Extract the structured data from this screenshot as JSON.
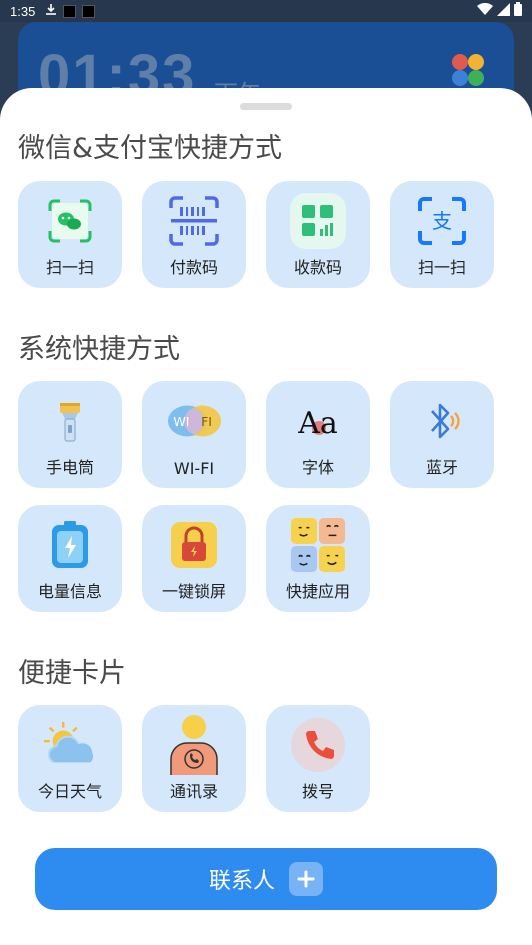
{
  "status_bar": {
    "time": "1:35"
  },
  "background": {
    "clock": "01:33",
    "ampm": "下午"
  },
  "sections": {
    "pay": {
      "title": "微信&支付宝快捷方式",
      "items": [
        {
          "label": "扫一扫",
          "icon": "wechat-scan-icon"
        },
        {
          "label": "付款码",
          "icon": "payment-code-icon"
        },
        {
          "label": "收款码",
          "icon": "receive-code-icon"
        },
        {
          "label": "扫一扫",
          "icon": "alipay-scan-icon"
        }
      ]
    },
    "system": {
      "title": "系统快捷方式",
      "items": [
        {
          "label": "手电筒",
          "icon": "flashlight-icon"
        },
        {
          "label": "WI-FI",
          "icon": "wifi-icon",
          "icon_text_left": "WI",
          "icon_text_right": "FI"
        },
        {
          "label": "字体",
          "icon": "font-icon",
          "icon_text": "Aa"
        },
        {
          "label": "蓝牙",
          "icon": "bluetooth-icon"
        },
        {
          "label": "电量信息",
          "icon": "battery-icon"
        },
        {
          "label": "一键锁屏",
          "icon": "lock-screen-icon"
        },
        {
          "label": "快捷应用",
          "icon": "quick-apps-icon"
        }
      ]
    },
    "cards": {
      "title": "便捷卡片",
      "items": [
        {
          "label": "今日天气",
          "icon": "weather-icon"
        },
        {
          "label": "通讯录",
          "icon": "contacts-icon"
        },
        {
          "label": "拨号",
          "icon": "phone-icon"
        }
      ]
    }
  },
  "contact_button": {
    "label": "联系人"
  },
  "colors": {
    "accent": "#2e8bf0",
    "tile_bg": "#d5e8fb"
  }
}
